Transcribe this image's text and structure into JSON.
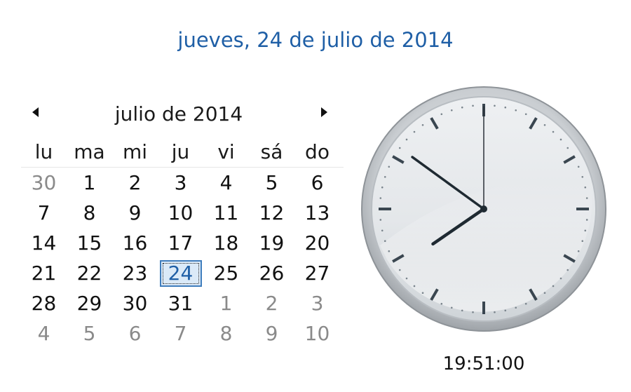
{
  "header": {
    "long_date": "jueves, 24 de julio de 2014"
  },
  "calendar": {
    "month_title": "julio de 2014",
    "prev_icon": "triangle-left-icon",
    "next_icon": "triangle-right-icon",
    "weekdays": [
      "lu",
      "ma",
      "mi",
      "ju",
      "vi",
      "sá",
      "do"
    ],
    "weeks": [
      [
        {
          "d": "30",
          "o": true
        },
        {
          "d": "1"
        },
        {
          "d": "2"
        },
        {
          "d": "3"
        },
        {
          "d": "4"
        },
        {
          "d": "5"
        },
        {
          "d": "6"
        }
      ],
      [
        {
          "d": "7"
        },
        {
          "d": "8"
        },
        {
          "d": "9"
        },
        {
          "d": "10"
        },
        {
          "d": "11"
        },
        {
          "d": "12"
        },
        {
          "d": "13"
        }
      ],
      [
        {
          "d": "14"
        },
        {
          "d": "15"
        },
        {
          "d": "16"
        },
        {
          "d": "17"
        },
        {
          "d": "18"
        },
        {
          "d": "19"
        },
        {
          "d": "20"
        }
      ],
      [
        {
          "d": "21"
        },
        {
          "d": "22"
        },
        {
          "d": "23"
        },
        {
          "d": "24",
          "t": true
        },
        {
          "d": "25"
        },
        {
          "d": "26"
        },
        {
          "d": "27"
        }
      ],
      [
        {
          "d": "28"
        },
        {
          "d": "29"
        },
        {
          "d": "30"
        },
        {
          "d": "31"
        },
        {
          "d": "1",
          "o": true
        },
        {
          "d": "2",
          "o": true
        },
        {
          "d": "3",
          "o": true
        }
      ],
      [
        {
          "d": "4",
          "o": true
        },
        {
          "d": "5",
          "o": true
        },
        {
          "d": "6",
          "o": true
        },
        {
          "d": "7",
          "o": true
        },
        {
          "d": "8",
          "o": true
        },
        {
          "d": "9",
          "o": true
        },
        {
          "d": "10",
          "o": true
        }
      ]
    ]
  },
  "clock": {
    "time_text": "19:51:00",
    "hours": 19,
    "minutes": 51,
    "seconds": 0
  },
  "colors": {
    "accent": "#1f5fa6",
    "today_fill": "#dbeaf8",
    "other_month": "#8a8a8a"
  }
}
